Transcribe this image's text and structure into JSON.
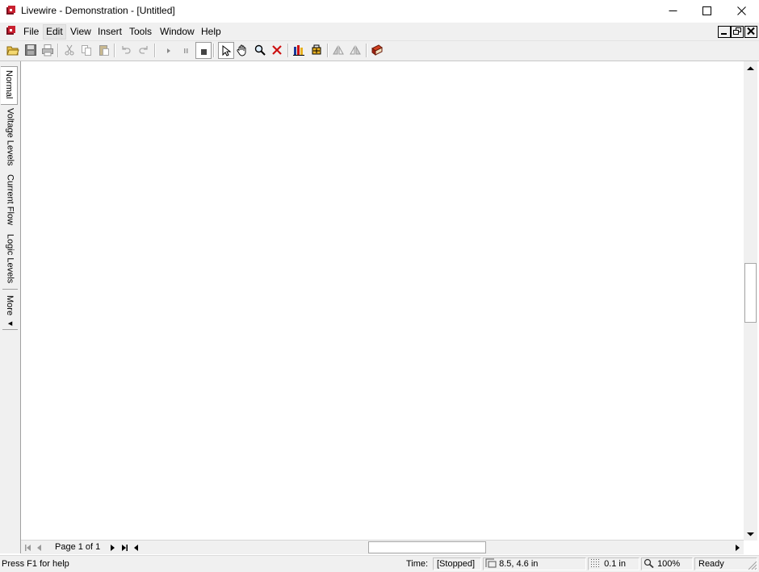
{
  "window": {
    "title": "Livewire - Demonstration - [Untitled]",
    "controls": {
      "minimize": "minimize",
      "maximize": "maximize",
      "close": "close"
    }
  },
  "menu": {
    "items": [
      {
        "label": "File"
      },
      {
        "label": "Edit"
      },
      {
        "label": "View"
      },
      {
        "label": "Insert"
      },
      {
        "label": "Tools"
      },
      {
        "label": "Window"
      },
      {
        "label": "Help"
      }
    ]
  },
  "toolbar": {
    "buttons": [
      "open-folder-icon",
      "save-icon",
      "print-icon",
      "cut-icon",
      "copy-icon",
      "paste-icon",
      "undo-icon",
      "redo-icon",
      "play-icon",
      "pause-icon",
      "stop-icon",
      "pointer-icon",
      "hand-icon",
      "zoom-icon",
      "delete-icon",
      "gallery-icon",
      "components-icon",
      "flip-horizontal-icon",
      "flip-vertical-icon",
      "book-icon"
    ]
  },
  "left_tabs": [
    {
      "label": "Normal"
    },
    {
      "label": "Voltage Levels"
    },
    {
      "label": "Current Flow"
    },
    {
      "label": "Logic Levels"
    },
    {
      "label": "More ◂"
    }
  ],
  "page_nav": {
    "label": "Page 1 of 1"
  },
  "status": {
    "help": "Press F1 for help",
    "time_label": "Time:",
    "time_value": "[Stopped]",
    "size": "8.5, 4.6 in",
    "grid": "0.1 in",
    "zoom": "100%",
    "ready": "Ready"
  },
  "colors": {
    "accent_red": "#cc1111",
    "app_icon": "#7a1020",
    "chrome": "#f0f0f0"
  }
}
